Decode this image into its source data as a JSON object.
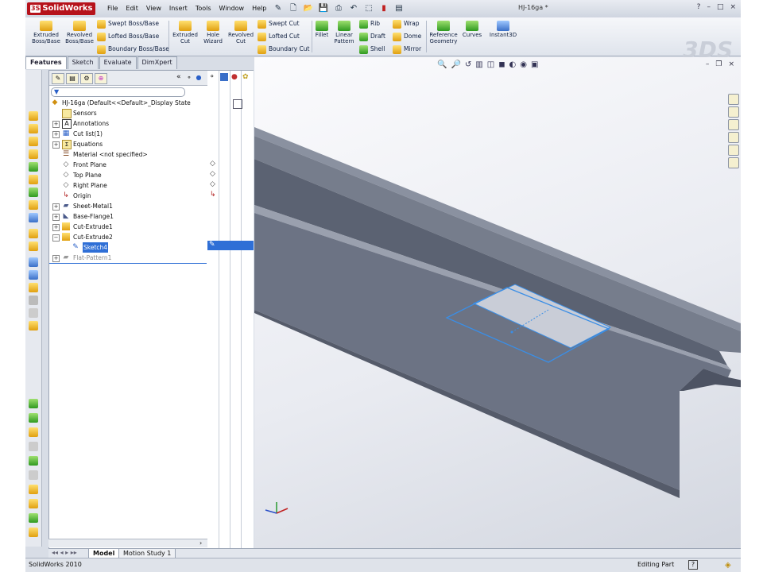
{
  "app": {
    "logo_text": "SolidWorks",
    "document_title": "HJ-16ga *",
    "menus": [
      "File",
      "Edit",
      "View",
      "Insert",
      "Tools",
      "Window",
      "Help"
    ],
    "window_controls": [
      "?",
      "–",
      "□",
      "×"
    ]
  },
  "command_manager": {
    "extruded_boss": "Extruded Boss/Base",
    "revolved_boss": "Revolved Boss/Base",
    "swept_boss": "Swept Boss/Base",
    "lofted_boss": "Lofted Boss/Base",
    "boundary_boss": "Boundary Boss/Base",
    "extruded_cut": "Extruded Cut",
    "hole_wizard": "Hole Wizard",
    "revolved_cut": "Revolved Cut",
    "swept_cut": "Swept Cut",
    "lofted_cut": "Lofted Cut",
    "boundary_cut": "Boundary Cut",
    "fillet": "Fillet",
    "linear_pattern": "Linear Pattern",
    "rib": "Rib",
    "draft": "Draft",
    "shell": "Shell",
    "wrap": "Wrap",
    "dome": "Dome",
    "mirror": "Mirror",
    "reference_geometry": "Reference Geometry",
    "curves": "Curves",
    "instant3d": "Instant3D",
    "tabs": [
      "Features",
      "Sketch",
      "Evaluate",
      "DimXpert"
    ]
  },
  "tree": {
    "filter_icon": "filter-icon",
    "root": "HJ-16ga  (Default<<Default>_Display State",
    "items": [
      {
        "label": "Sensors",
        "icon": "sensors-icon"
      },
      {
        "label": "Annotations",
        "icon": "annotations-icon"
      },
      {
        "label": "Cut list(1)",
        "icon": "cut-list-icon"
      },
      {
        "label": "Equations",
        "icon": "equations-icon"
      },
      {
        "label": "Material <not specified>",
        "icon": "material-icon"
      },
      {
        "label": "Front Plane",
        "icon": "plane-icon"
      },
      {
        "label": "Top Plane",
        "icon": "plane-icon"
      },
      {
        "label": "Right Plane",
        "icon": "plane-icon"
      },
      {
        "label": "Origin",
        "icon": "origin-icon"
      },
      {
        "label": "Sheet-Metal1",
        "icon": "sheet-metal-icon"
      },
      {
        "label": "Base-Flange1",
        "icon": "base-flange-icon"
      },
      {
        "label": "Cut-Extrude1",
        "icon": "cut-extrude-icon"
      },
      {
        "label": "Cut-Extrude2",
        "icon": "cut-extrude-icon"
      },
      {
        "label": "Sketch4",
        "icon": "sketch-icon"
      },
      {
        "label": "Flat-Pattern1",
        "icon": "flat-pattern-icon"
      }
    ]
  },
  "bottom_tabs": [
    "Model",
    "Motion Study 1"
  ],
  "status": {
    "app_version": "SolidWorks 2010",
    "mode": "Editing Part"
  },
  "colors": {
    "brand_red": "#b6121b",
    "selection_blue": "#2f6fd6",
    "sketch_blue": "#3a8ee6",
    "model_gray": "#6c7384"
  }
}
